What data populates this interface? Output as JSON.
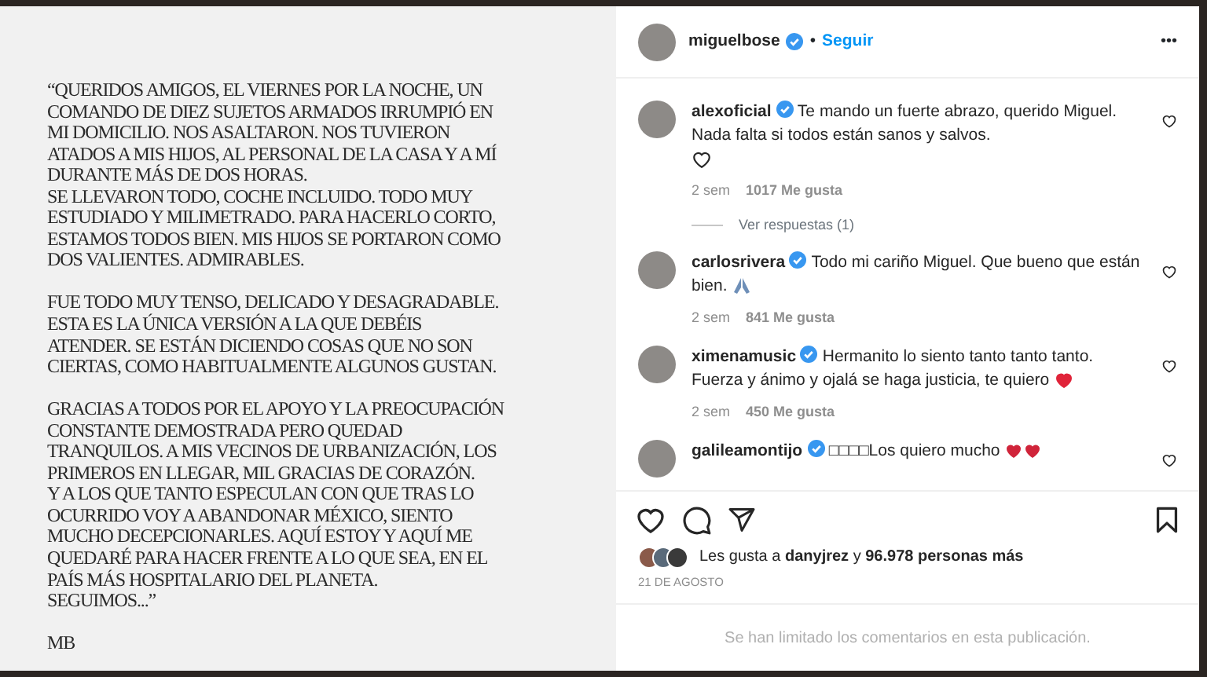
{
  "post_image": {
    "paragraphs": [
      "“QUERIDOS AMIGOS, EL VIERNES POR LA NOCHE, UN\nCOMANDO DE DIEZ SUJETOS ARMADOS IRRUMPIÓ EN\nMI DOMICILIO. NOS ASALTARON. NOS TUVIERON\nATADOS A MIS HIJOS, AL PERSONAL DE LA CASA Y A MÍ\nDURANTE MÁS DE DOS HORAS.\nSE LLEVARON TODO, COCHE INCLUIDO. TODO MUY\nESTUDIADO Y MILIMETRADO. PARA HACERLO CORTO,\nESTAMOS TODOS BIEN. MIS HIJOS SE PORTARON COMO\nDOS VALIENTES. ADMIRABLES.",
      "FUE TODO MUY TENSO, DELICADO Y DESAGRADABLE.\nESTA ES LA ÚNICA VERSIÓN A LA QUE DEBÉIS\nATENDER. SE ESTÁN DICIENDO COSAS QUE NO SON\nCIERTAS, COMO HABITUALMENTE ALGUNOS GUSTAN.",
      "GRACIAS A TODOS POR EL APOYO Y LA PREOCUPACIÓN\nCONSTANTE DEMOSTRADA PERO QUEDAD\nTRANQUILOS. A MIS VECINOS DE URBANIZACIÓN, LOS\nPRIMEROS EN LLEGAR, MIL GRACIAS DE CORAZÓN.\nY A LOS QUE TANTO ESPECULAN CON QUE TRAS LO\nOCURRIDO VOY A ABANDONAR MÉXICO, SIENTO\nMUCHO DECEPCIONARLES. AQUÍ ESTOY Y AQUÍ ME\nQUEDARÉ PARA HACER FRENTE A LO QUE SEA, EN EL\nPAÍS MÁS HOSPITALARIO DEL PLANETA.\nSEGUIMOS...”",
      "MB"
    ]
  },
  "header": {
    "username": "miguelbose",
    "verified": true,
    "separator": "•",
    "follow": "Seguir",
    "more": "•••"
  },
  "comments": [
    {
      "username": "alexoficial",
      "verified": true,
      "text": "Te mando un fuerte abrazo, querido Miguel. Nada falta si todos están sanos y salvos.",
      "kind": "outline-heart",
      "age": "2 sem",
      "likes": "1017 Me gusta",
      "replies": "Ver respuestas (1)"
    },
    {
      "username": "carlosrivera",
      "verified": true,
      "text": "Todo mi cariño Miguel. Que bueno que están bien.",
      "kind": "praying-hands",
      "age": "2 sem",
      "likes": "841 Me gusta"
    },
    {
      "username": "ximenamusic",
      "verified": true,
      "text": "Hermanito lo siento tanto tanto tanto. Fuerza y ánimo y ojalá se haga justicia, te quiero",
      "kind": "red-heart",
      "age": "2 sem",
      "likes": "450 Me gusta"
    },
    {
      "username": "galileamontijo",
      "verified": true,
      "text": "□□□□Los quiero mucho",
      "kind": "two-hearts"
    }
  ],
  "likes": {
    "prefix": "Les gusta a",
    "user": "danyjrez",
    "joiner": "y",
    "count": "96.978 personas más"
  },
  "date": "21 DE AGOSTO",
  "footer": "Se han limitado los comentarios en esta publicación."
}
